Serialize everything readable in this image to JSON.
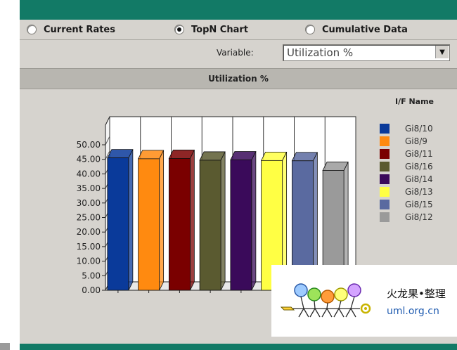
{
  "radios": [
    {
      "label": "Current Rates",
      "selected": false
    },
    {
      "label": "TopN Chart",
      "selected": true
    },
    {
      "label": "Cumulative Data",
      "selected": false
    }
  ],
  "variable": {
    "label": "Variable:",
    "value": "Utilization %"
  },
  "panel_title": "Utilization %",
  "legend_title": "I/F Name",
  "chart_data": {
    "type": "bar",
    "title": "Utilization %",
    "xlabel": "",
    "ylabel": "",
    "ylim": [
      0,
      50
    ],
    "yticks": [
      "0.00",
      "5.00",
      "10.00",
      "15.00",
      "20.00",
      "25.00",
      "30.00",
      "35.00",
      "40.00",
      "45.00",
      "50.00"
    ],
    "categories": [
      "Gi8/10",
      "Gi8/9",
      "Gi8/11",
      "Gi8/16",
      "Gi8/14",
      "Gi8/13",
      "Gi8/15",
      "Gi8/12"
    ],
    "values": [
      45.5,
      45.2,
      45.3,
      44.7,
      44.8,
      44.6,
      44.5,
      41.2
    ],
    "colors": [
      "#0a3a9a",
      "#ff8a10",
      "#7a0000",
      "#5a5a30",
      "#3a0a5a",
      "#ffff44",
      "#5a6aa0",
      "#9a9a9a"
    ],
    "grid": true,
    "legend": "right"
  },
  "logo": {
    "cn_text": "火龙果•整理",
    "url": "uml.org.cn"
  }
}
